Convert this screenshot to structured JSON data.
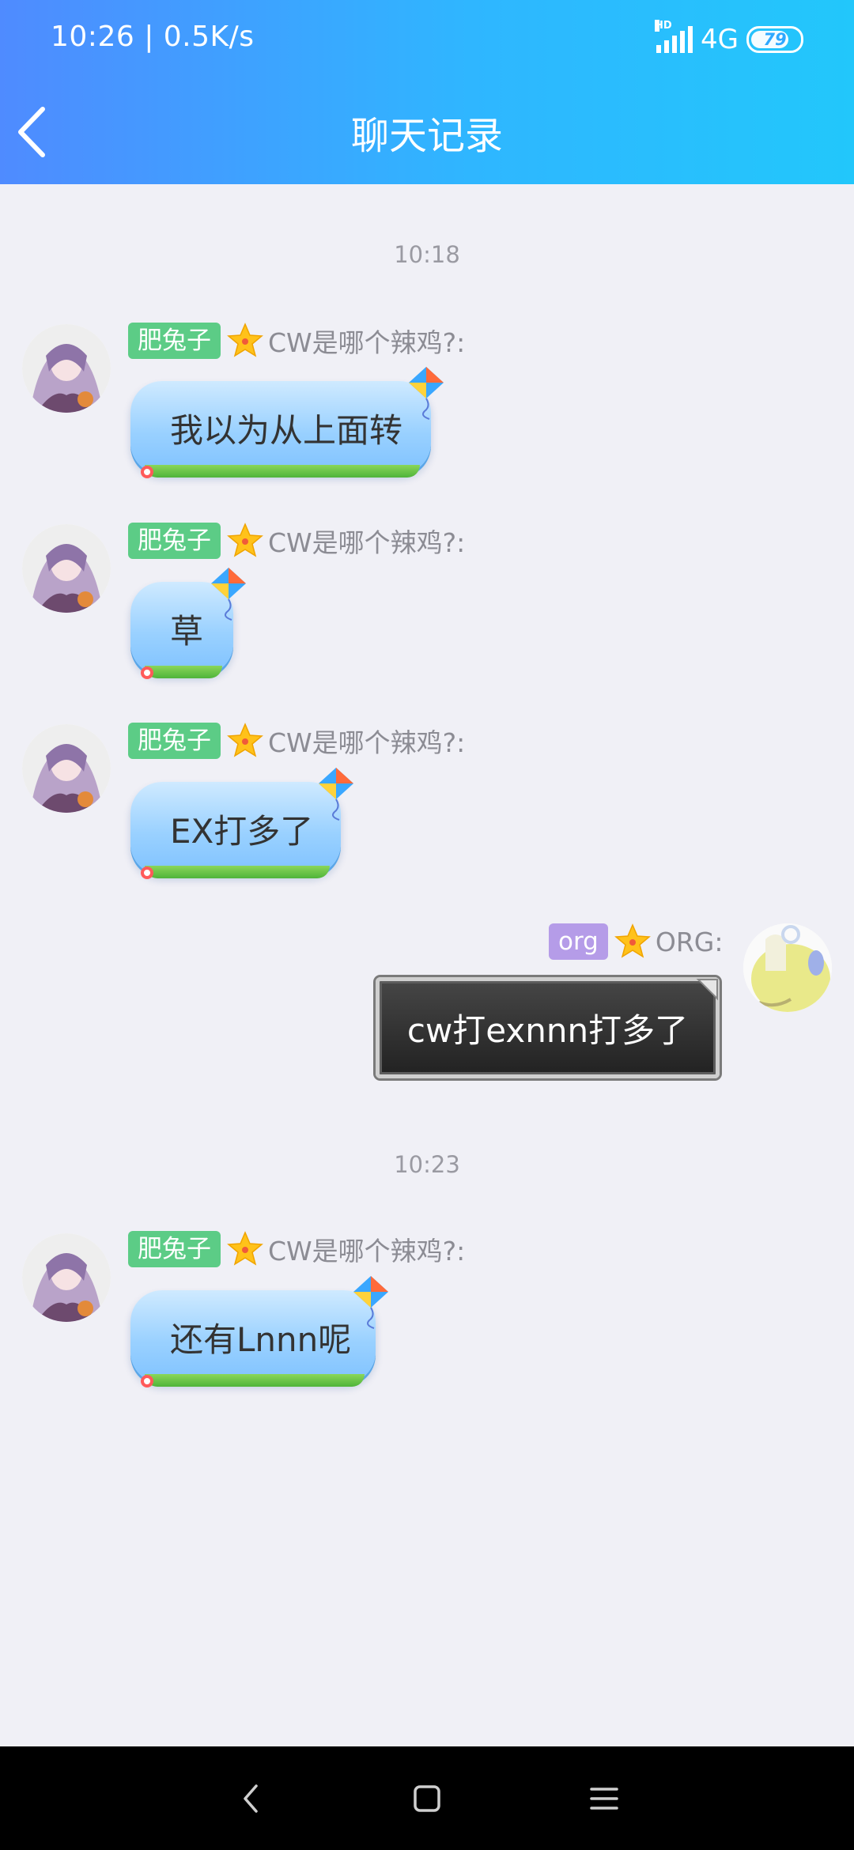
{
  "status_bar": {
    "time": "10:26",
    "speed": "0.5K/s",
    "network": "4G",
    "hd": "HD",
    "battery": "79"
  },
  "header": {
    "back_icon": "chevron-left-icon",
    "title": "聊天记录"
  },
  "messages": [
    {
      "type": "timestamp",
      "text": "10:18"
    },
    {
      "type": "incoming",
      "tag": "肥兔子",
      "sender": "CW是哪个辣鸡?:",
      "text": "我以为从上面转"
    },
    {
      "type": "incoming",
      "tag": "肥兔子",
      "sender": "CW是哪个辣鸡?:",
      "text": "草"
    },
    {
      "type": "incoming",
      "tag": "肥兔子",
      "sender": "CW是哪个辣鸡?:",
      "text": "EX打多了"
    },
    {
      "type": "outgoing",
      "tag": "org",
      "sender": "ORG:",
      "text": "cw打exnnn打多了"
    },
    {
      "type": "timestamp",
      "text": "10:23"
    },
    {
      "type": "incoming",
      "tag": "肥兔子",
      "sender": "CW是哪个辣鸡?:",
      "text": "还有Lnnn呢"
    }
  ],
  "colors": {
    "header_start": "#4f8bff",
    "header_end": "#22c7fb",
    "tag_green": "#5ccc86",
    "tag_purple": "#b59ce8",
    "background": "#f0f0f6"
  },
  "nav_bar": {
    "back": "back-triangle-icon",
    "home": "home-square-icon",
    "menu": "menu-lines-icon"
  }
}
